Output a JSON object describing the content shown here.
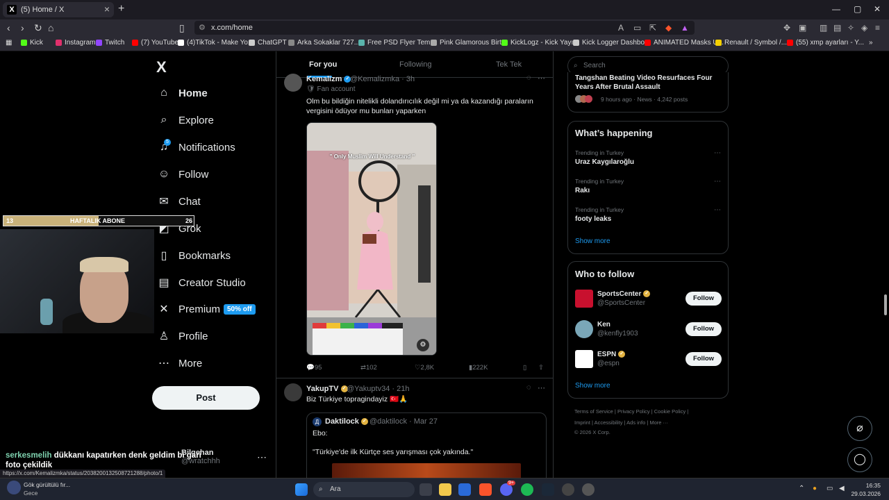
{
  "browser": {
    "tab_title": "(5) Home / X",
    "tab_favicon": "X",
    "url": "x.com/home",
    "bookmarks": [
      {
        "label": "Kick",
        "color": "#53fc18"
      },
      {
        "label": "Instagram",
        "color": "#e1306c"
      },
      {
        "label": "Twitch",
        "color": "#9146ff"
      },
      {
        "label": "(7) YouTube",
        "color": "#ff0000"
      },
      {
        "label": "(4)TikTok - Make Yo...",
        "color": "#ffffff"
      },
      {
        "label": "ChatGPT",
        "color": "#cccccc"
      },
      {
        "label": "Arka Sokaklar 727...",
        "color": "#888888"
      },
      {
        "label": "Free PSD Flyer Tem...",
        "color": "#5ab4ac"
      },
      {
        "label": "Pink Glamorous Birt...",
        "color": "#aaaaaa"
      },
      {
        "label": "KickLogz - Kick Yayı...",
        "color": "#53fc18"
      },
      {
        "label": "Kick Logger Dashbo...",
        "color": "#cccccc"
      },
      {
        "label": "ANIMATED Masks U...",
        "color": "#ff0000"
      },
      {
        "label": "Renault / Symbol /...",
        "color": "#f5d000"
      },
      {
        "label": "(55) xmp ayarları - Y...",
        "color": "#ff0000"
      }
    ]
  },
  "nav": {
    "logo": "X",
    "items": [
      {
        "label": "Home",
        "icon": "home-icon",
        "glyph": "⌂"
      },
      {
        "label": "Explore",
        "icon": "search-icon",
        "glyph": "⌕"
      },
      {
        "label": "Notifications",
        "icon": "bell-icon",
        "glyph": "♫"
      },
      {
        "label": "Follow",
        "icon": "person-add-icon",
        "glyph": "☺"
      },
      {
        "label": "Chat",
        "icon": "mail-icon",
        "glyph": "✉"
      },
      {
        "label": "Grok",
        "icon": "grok-icon",
        "glyph": "◩"
      },
      {
        "label": "Bookmarks",
        "icon": "bookmark-icon",
        "glyph": "▯"
      },
      {
        "label": "Creator Studio",
        "icon": "studio-icon",
        "glyph": "▤"
      },
      {
        "label": "Premium",
        "icon": "premium-icon",
        "glyph": "✕"
      },
      {
        "label": "Profile",
        "icon": "profile-icon",
        "glyph": "♙"
      },
      {
        "label": "More",
        "icon": "more-icon",
        "glyph": "⋯"
      }
    ],
    "notif_count": "5",
    "premium_badge": "50% off",
    "post_label": "Post",
    "account_name": "Bilgehan",
    "account_handle": "@wratchhh"
  },
  "overlay": {
    "sub_left": "13",
    "sub_label": "HAFTALIK ABONE",
    "sub_right": "26",
    "sub_progress": 0.5,
    "chat_user": "serkesmelih",
    "chat_msg": "dükkanı kapatırken denk geldim bi gari foto çekildik"
  },
  "timeline": {
    "tabs": [
      "For you",
      "Following",
      "Tek Tek"
    ],
    "tweet1": {
      "name": "Kemalizm",
      "handle": "@Kemalizmka · 3h",
      "tag": "Fan account",
      "text": "Olm bu bildiğin nitelikli dolandırıcılık değil mi ya da kazandığı paraların vergisini ödüyor mu bunları yaparken",
      "media_caption": "\" Only Muslim Will Understand \"",
      "replies": "95",
      "reposts": "102",
      "likes": "2,8K",
      "views": "222K"
    },
    "tweet2": {
      "name": "YakupTV",
      "handle": "@Yakuptv34 · 21h",
      "text": "Biz Türkiye topragindayiz 🇹🇷🙏",
      "quote_name": "Daktilock",
      "quote_handle": "@daktilock · Mar 27",
      "quote_line1": "Ebo:",
      "quote_line2": "\"Türkiye'de ilk Kürtçe ses yarışması çok yakında.\""
    }
  },
  "right": {
    "search_placeholder": "Search",
    "news_title": "Tangshan Beating Video Resurfaces Four Years After Brutal Assault",
    "news_meta": "9 hours ago · News · 4,242 posts",
    "happening_title": "What’s happening",
    "trends": [
      {
        "cat": "Trending in Turkey",
        "name": "Uraz Kaygılaroğlu"
      },
      {
        "cat": "Trending in Turkey",
        "name": "Rakı"
      },
      {
        "cat": "Trending in Turkey",
        "name": "footy leaks"
      }
    ],
    "show_more": "Show more",
    "wtf_title": "Who to follow",
    "follow_label": "Follow",
    "suggestions": [
      {
        "name": "SportsCenter",
        "handle": "@SportsCenter",
        "color": "#c8102e"
      },
      {
        "name": "Ken",
        "handle": "@kenfly1903",
        "color": "#7aa7b8"
      },
      {
        "name": "ESPN",
        "handle": "@espn",
        "color": "#ffffff"
      }
    ],
    "footer1": "Terms of Service  |  Privacy Policy  |  Cookie Policy  |",
    "footer2": "Imprint  |  Accessibility  |  Ads info  |  More ···",
    "footer3": "© 2026 X Corp."
  },
  "status_url": "https://x.com/Kemalizmka/status/2038200132508721288/photo/1",
  "taskbar": {
    "weather_title": "Gök gürültülü fır...",
    "weather_sub": "Gece",
    "search_label": "Ara",
    "time": "16:35",
    "date": "29.03.2026",
    "discord_badge": "9+"
  }
}
